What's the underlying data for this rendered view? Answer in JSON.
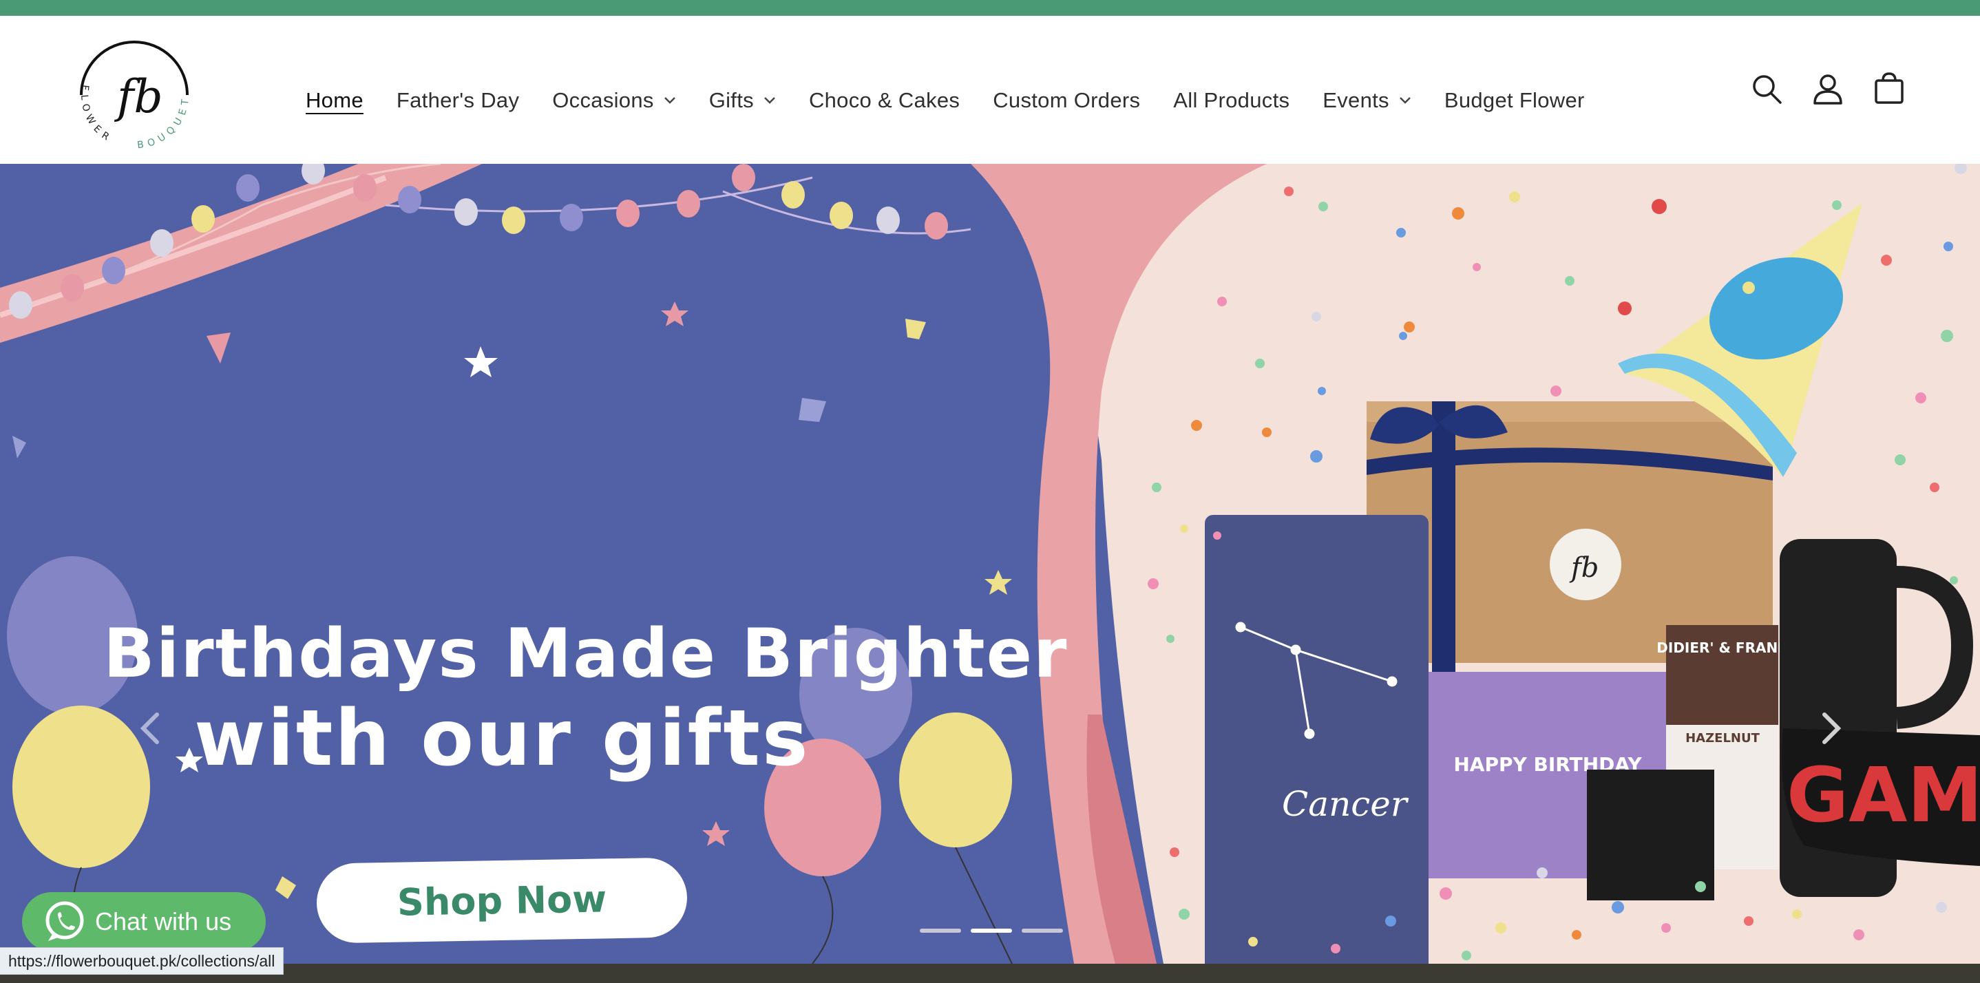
{
  "brand": {
    "logo_monogram": "fb",
    "logo_text_1": "FLOWER",
    "logo_text_2": "BOUQUET",
    "accent_color": "#4a9a76"
  },
  "nav": {
    "items": [
      {
        "label": "Home",
        "active": true,
        "dropdown": false
      },
      {
        "label": "Father's Day",
        "active": false,
        "dropdown": false
      },
      {
        "label": "Occasions",
        "active": false,
        "dropdown": true
      },
      {
        "label": "Gifts",
        "active": false,
        "dropdown": true
      },
      {
        "label": "Choco & Cakes",
        "active": false,
        "dropdown": false
      },
      {
        "label": "Custom Orders",
        "active": false,
        "dropdown": false
      },
      {
        "label": "All Products",
        "active": false,
        "dropdown": false
      },
      {
        "label": "Events",
        "active": false,
        "dropdown": true
      },
      {
        "label": "Budget Flower",
        "active": false,
        "dropdown": false
      }
    ]
  },
  "header_icons": [
    "search-icon",
    "account-icon",
    "cart-icon"
  ],
  "hero": {
    "headline_line1": "Birthdays Made Brighter",
    "headline_line2": "with our gifts",
    "cta_label": "Shop Now",
    "banner_bg": "#5260a6",
    "product_labels": {
      "notebook": "Cancer",
      "card": "HAPPY BIRTHDAY",
      "choco_brand": "DIDIER' & FRANK",
      "choco_flavor": "HAZELNUT",
      "socks_text": "GAME",
      "box_monogram": "fb"
    },
    "slides": {
      "count": 3,
      "active_index": 1
    }
  },
  "chat": {
    "label": "Chat with us",
    "color": "#5fb96b"
  },
  "status_bar": {
    "url": "https://flowerbouquet.pk/collections/all"
  }
}
